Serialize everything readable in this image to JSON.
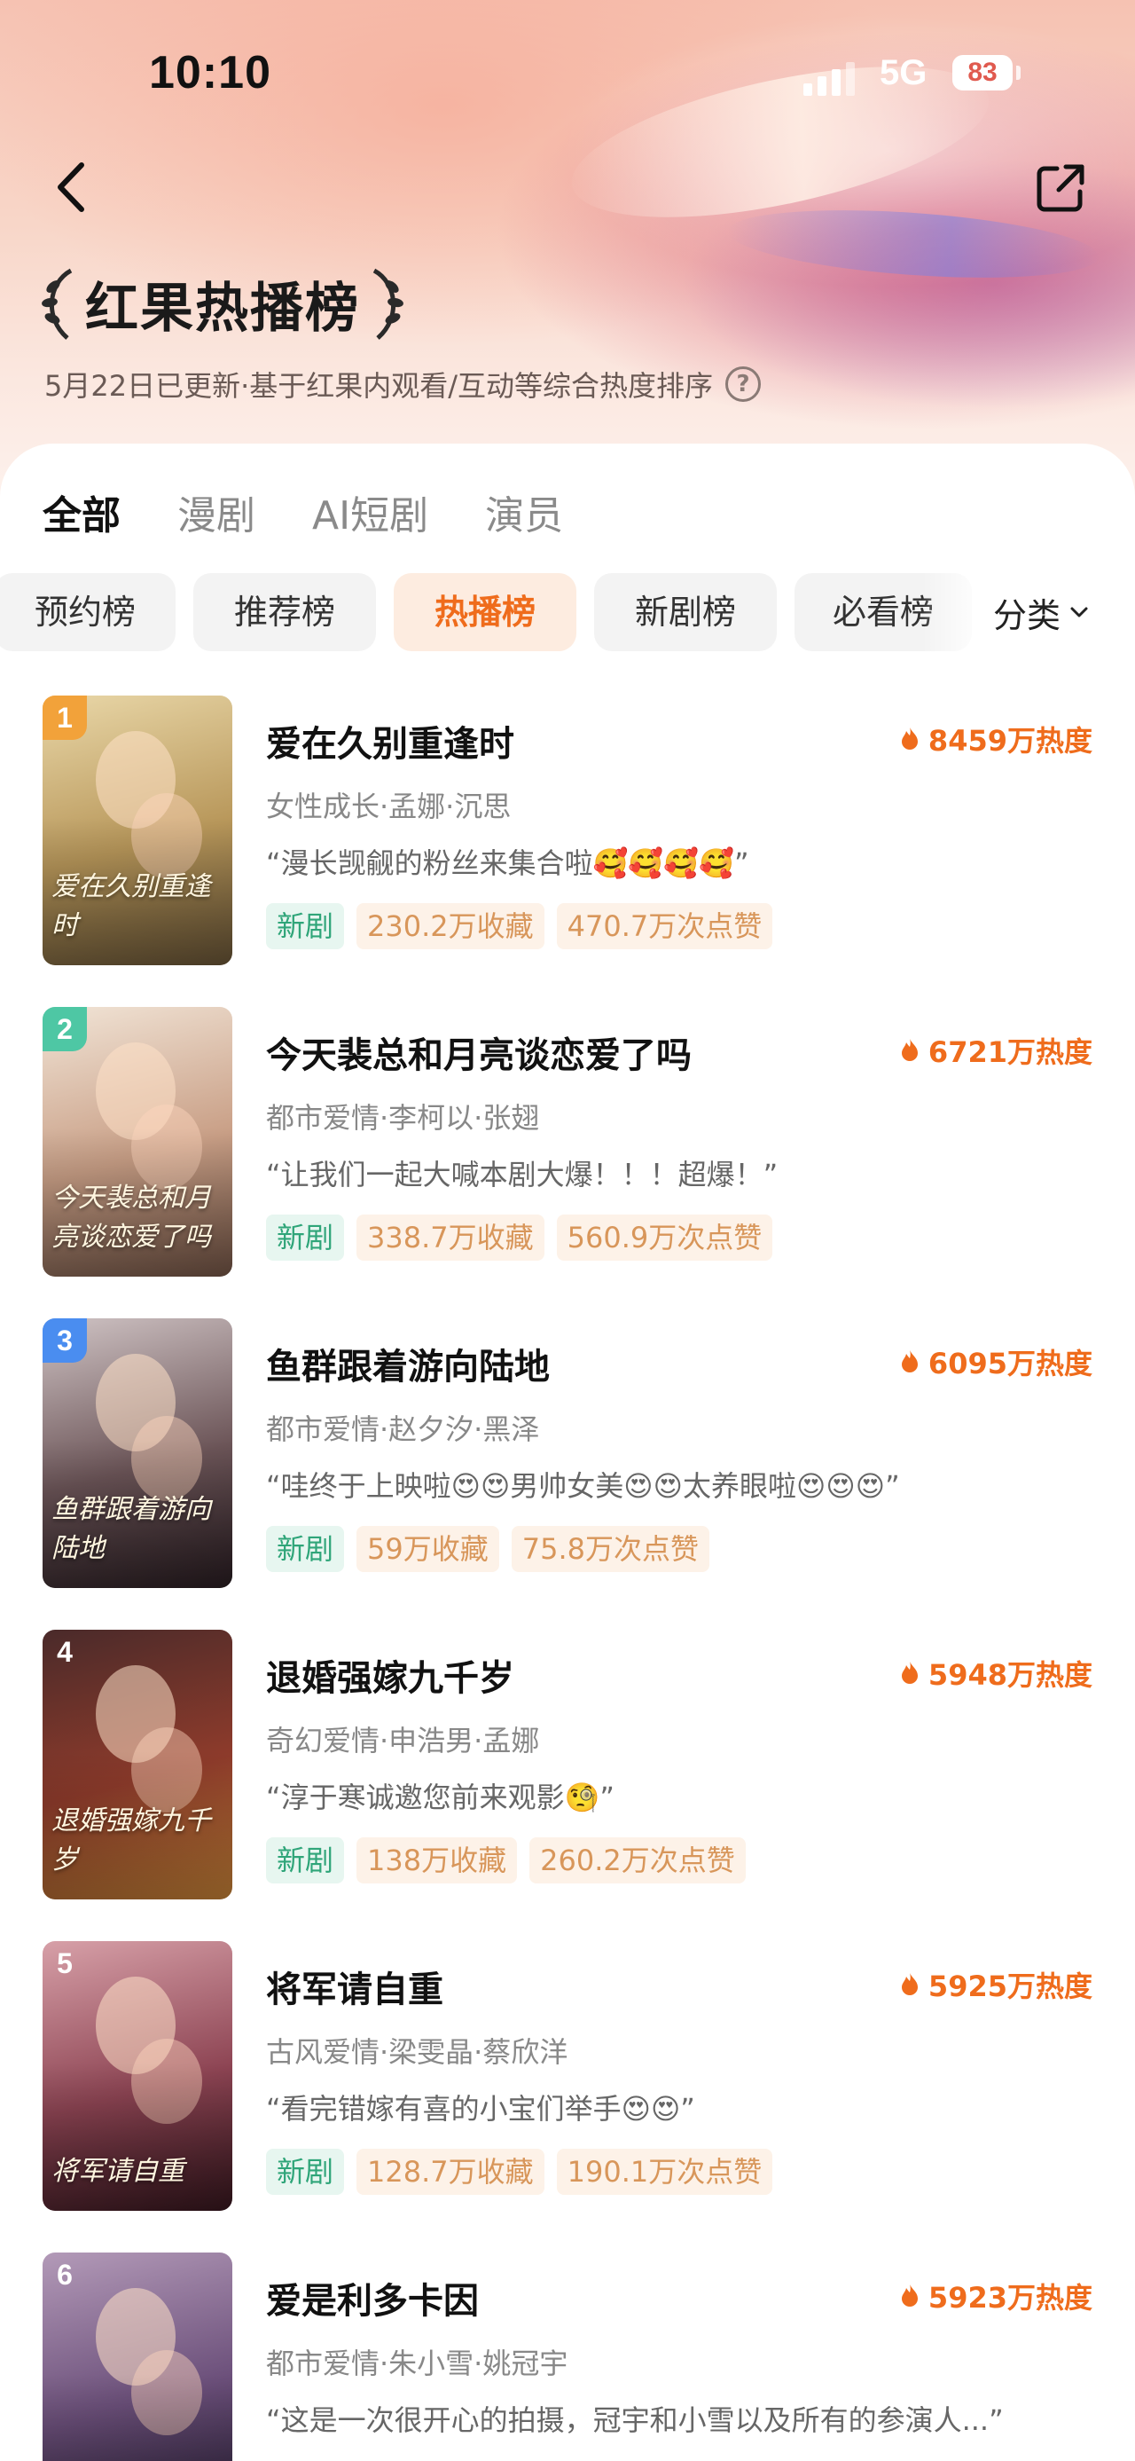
{
  "status_bar": {
    "time": "10:10",
    "network": "5G",
    "battery": "83"
  },
  "header": {
    "title": "红果热播榜",
    "subtitle": "5月22日已更新·基于红果内观看/互动等综合热度排序",
    "help_glyph": "?"
  },
  "category_tabs": [
    {
      "label": "全部",
      "active": true
    },
    {
      "label": "漫剧",
      "active": false
    },
    {
      "label": "AI短剧",
      "active": false
    },
    {
      "label": "演员",
      "active": false
    }
  ],
  "rank_tabs": [
    {
      "label": "预约榜",
      "active": false
    },
    {
      "label": "推荐榜",
      "active": false
    },
    {
      "label": "热播榜",
      "active": true
    },
    {
      "label": "新剧榜",
      "active": false
    },
    {
      "label": "必看榜",
      "active": false
    }
  ],
  "sort_label": "分类",
  "colors": {
    "accent": "#ef6c1c",
    "new_tag": "#2fa579",
    "stat_tag": "#d8965a"
  },
  "dramas": [
    {
      "rank": "1",
      "rank_color": "#f2a23a",
      "title": "爱在久别重逢时",
      "poster_text": "爱在久别重逢时",
      "heat": "8459万热度",
      "meta": "女性成长·孟娜·沉思",
      "quote": "“漫长觊觎的粉丝来集合啦🥰🥰🥰🥰”",
      "new_tag": "新剧",
      "favorites": "230.2万收藏",
      "likes": "470.7万次点赞",
      "poster_colors": [
        "#e9d7a8",
        "#b8975a",
        "#6f5a3a"
      ]
    },
    {
      "rank": "2",
      "rank_color": "#4ec7a4",
      "title": "今天裴总和月亮谈恋爱了吗",
      "poster_text": "今天裴总和月亮谈恋爱了吗",
      "heat": "6721万热度",
      "meta": "都市爱情·李柯以·张翅",
      "quote": "“让我们一起大喊本剧大爆！！！超爆！”",
      "new_tag": "新剧",
      "favorites": "338.7万收藏",
      "likes": "560.9万次点赞",
      "poster_colors": [
        "#f1e4d6",
        "#c99f86",
        "#7a5a4a"
      ]
    },
    {
      "rank": "3",
      "rank_color": "#4a8df0",
      "title": "鱼群跟着游向陆地",
      "poster_text": "鱼群跟着游向陆地",
      "heat": "6095万热度",
      "meta": "都市爱情·赵夕汐·黑泽",
      "quote": "“哇终于上映啦😍😍男帅女美😍😍太养眼啦😍😍😍”",
      "new_tag": "新剧",
      "favorites": "59万收藏",
      "likes": "75.8万次点赞",
      "poster_colors": [
        "#cfc3c4",
        "#6c5558",
        "#2c1f24"
      ]
    },
    {
      "rank": "4",
      "rank_color": "rgba(0,0,0,0)",
      "title": "退婚强嫁九千岁",
      "poster_text": "退婚强嫁九千岁",
      "heat": "5948万热度",
      "meta": "奇幻爱情·申浩男·孟娜",
      "quote": "“淳于寒诚邀您前来观影🧐”",
      "new_tag": "新剧",
      "favorites": "138万收藏",
      "likes": "260.2万次点赞",
      "poster_colors": [
        "#4a2a2a",
        "#8e3b2b",
        "#d28a3a"
      ]
    },
    {
      "rank": "5",
      "rank_color": "rgba(0,0,0,0)",
      "title": "将军请自重",
      "poster_text": "将军请自重",
      "heat": "5925万热度",
      "meta": "古风爱情·梁雯晶·蔡欣洋",
      "quote": "“看完错嫁有喜的小宝们举手😍😍”",
      "new_tag": "新剧",
      "favorites": "128.7万收藏",
      "likes": "190.1万次点赞",
      "poster_colors": [
        "#d7a0a8",
        "#8d4453",
        "#3a1820"
      ]
    },
    {
      "rank": "6",
      "rank_color": "rgba(0,0,0,0)",
      "title": "爱是利多卡因",
      "poster_text": "爱是利多卡因",
      "heat": "5923万热度",
      "meta": "都市爱情·朱小雪·姚冠宇",
      "quote": "“这是一次很开心的拍摄，冠宇和小雪以及所有的参演人...”",
      "new_tag": "",
      "favorites": "",
      "likes": "",
      "poster_colors": [
        "#b39ab8",
        "#6b4f7a",
        "#2a2038"
      ]
    }
  ]
}
